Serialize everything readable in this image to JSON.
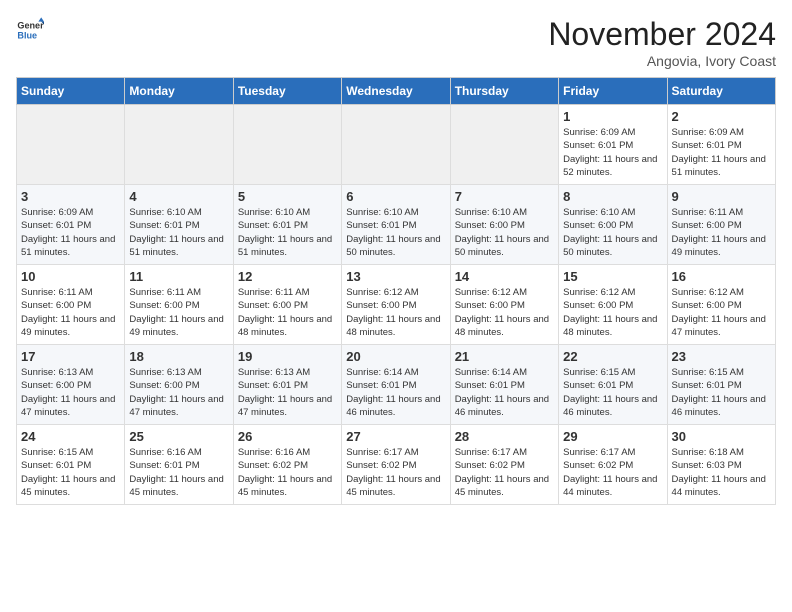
{
  "header": {
    "logo_line1": "General",
    "logo_line2": "Blue",
    "month": "November 2024",
    "location": "Angovia, Ivory Coast"
  },
  "weekdays": [
    "Sunday",
    "Monday",
    "Tuesday",
    "Wednesday",
    "Thursday",
    "Friday",
    "Saturday"
  ],
  "weeks": [
    [
      {
        "num": "",
        "info": ""
      },
      {
        "num": "",
        "info": ""
      },
      {
        "num": "",
        "info": ""
      },
      {
        "num": "",
        "info": ""
      },
      {
        "num": "",
        "info": ""
      },
      {
        "num": "1",
        "info": "Sunrise: 6:09 AM\nSunset: 6:01 PM\nDaylight: 11 hours and 52 minutes."
      },
      {
        "num": "2",
        "info": "Sunrise: 6:09 AM\nSunset: 6:01 PM\nDaylight: 11 hours and 51 minutes."
      }
    ],
    [
      {
        "num": "3",
        "info": "Sunrise: 6:09 AM\nSunset: 6:01 PM\nDaylight: 11 hours and 51 minutes."
      },
      {
        "num": "4",
        "info": "Sunrise: 6:10 AM\nSunset: 6:01 PM\nDaylight: 11 hours and 51 minutes."
      },
      {
        "num": "5",
        "info": "Sunrise: 6:10 AM\nSunset: 6:01 PM\nDaylight: 11 hours and 51 minutes."
      },
      {
        "num": "6",
        "info": "Sunrise: 6:10 AM\nSunset: 6:01 PM\nDaylight: 11 hours and 50 minutes."
      },
      {
        "num": "7",
        "info": "Sunrise: 6:10 AM\nSunset: 6:00 PM\nDaylight: 11 hours and 50 minutes."
      },
      {
        "num": "8",
        "info": "Sunrise: 6:10 AM\nSunset: 6:00 PM\nDaylight: 11 hours and 50 minutes."
      },
      {
        "num": "9",
        "info": "Sunrise: 6:11 AM\nSunset: 6:00 PM\nDaylight: 11 hours and 49 minutes."
      }
    ],
    [
      {
        "num": "10",
        "info": "Sunrise: 6:11 AM\nSunset: 6:00 PM\nDaylight: 11 hours and 49 minutes."
      },
      {
        "num": "11",
        "info": "Sunrise: 6:11 AM\nSunset: 6:00 PM\nDaylight: 11 hours and 49 minutes."
      },
      {
        "num": "12",
        "info": "Sunrise: 6:11 AM\nSunset: 6:00 PM\nDaylight: 11 hours and 48 minutes."
      },
      {
        "num": "13",
        "info": "Sunrise: 6:12 AM\nSunset: 6:00 PM\nDaylight: 11 hours and 48 minutes."
      },
      {
        "num": "14",
        "info": "Sunrise: 6:12 AM\nSunset: 6:00 PM\nDaylight: 11 hours and 48 minutes."
      },
      {
        "num": "15",
        "info": "Sunrise: 6:12 AM\nSunset: 6:00 PM\nDaylight: 11 hours and 48 minutes."
      },
      {
        "num": "16",
        "info": "Sunrise: 6:12 AM\nSunset: 6:00 PM\nDaylight: 11 hours and 47 minutes."
      }
    ],
    [
      {
        "num": "17",
        "info": "Sunrise: 6:13 AM\nSunset: 6:00 PM\nDaylight: 11 hours and 47 minutes."
      },
      {
        "num": "18",
        "info": "Sunrise: 6:13 AM\nSunset: 6:00 PM\nDaylight: 11 hours and 47 minutes."
      },
      {
        "num": "19",
        "info": "Sunrise: 6:13 AM\nSunset: 6:01 PM\nDaylight: 11 hours and 47 minutes."
      },
      {
        "num": "20",
        "info": "Sunrise: 6:14 AM\nSunset: 6:01 PM\nDaylight: 11 hours and 46 minutes."
      },
      {
        "num": "21",
        "info": "Sunrise: 6:14 AM\nSunset: 6:01 PM\nDaylight: 11 hours and 46 minutes."
      },
      {
        "num": "22",
        "info": "Sunrise: 6:15 AM\nSunset: 6:01 PM\nDaylight: 11 hours and 46 minutes."
      },
      {
        "num": "23",
        "info": "Sunrise: 6:15 AM\nSunset: 6:01 PM\nDaylight: 11 hours and 46 minutes."
      }
    ],
    [
      {
        "num": "24",
        "info": "Sunrise: 6:15 AM\nSunset: 6:01 PM\nDaylight: 11 hours and 45 minutes."
      },
      {
        "num": "25",
        "info": "Sunrise: 6:16 AM\nSunset: 6:01 PM\nDaylight: 11 hours and 45 minutes."
      },
      {
        "num": "26",
        "info": "Sunrise: 6:16 AM\nSunset: 6:02 PM\nDaylight: 11 hours and 45 minutes."
      },
      {
        "num": "27",
        "info": "Sunrise: 6:17 AM\nSunset: 6:02 PM\nDaylight: 11 hours and 45 minutes."
      },
      {
        "num": "28",
        "info": "Sunrise: 6:17 AM\nSunset: 6:02 PM\nDaylight: 11 hours and 45 minutes."
      },
      {
        "num": "29",
        "info": "Sunrise: 6:17 AM\nSunset: 6:02 PM\nDaylight: 11 hours and 44 minutes."
      },
      {
        "num": "30",
        "info": "Sunrise: 6:18 AM\nSunset: 6:03 PM\nDaylight: 11 hours and 44 minutes."
      }
    ]
  ]
}
